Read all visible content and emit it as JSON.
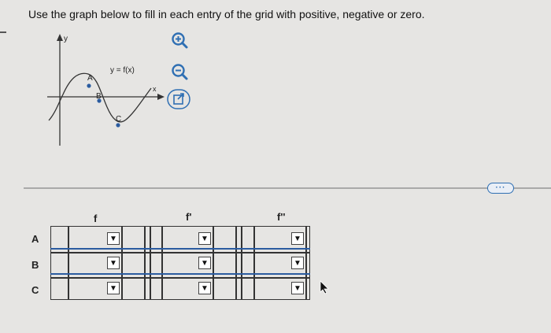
{
  "prompt": "Use the graph below to fill in each entry of the grid with positive, negative or zero.",
  "graph": {
    "y_axis_label": "y",
    "x_axis_label": "x",
    "curve_label": "y = f(x)",
    "points": [
      "A",
      "B",
      "C"
    ]
  },
  "toolbar": {
    "zoom_in_icon": "zoom-in-icon",
    "zoom_out_icon": "zoom-out-icon",
    "popout_icon": "external-link-icon",
    "more_icon": "ellipsis-icon"
  },
  "grid": {
    "columns": [
      "f",
      "f'",
      "f''"
    ],
    "rows": [
      "A",
      "B",
      "C"
    ],
    "cells": [
      [
        "",
        "",
        ""
      ],
      [
        "",
        "",
        ""
      ],
      [
        "",
        "",
        ""
      ]
    ]
  },
  "colors": {
    "accent": "#2f6fb3",
    "row_separator": "#2b5ca0",
    "background": "#e6e5e3"
  }
}
